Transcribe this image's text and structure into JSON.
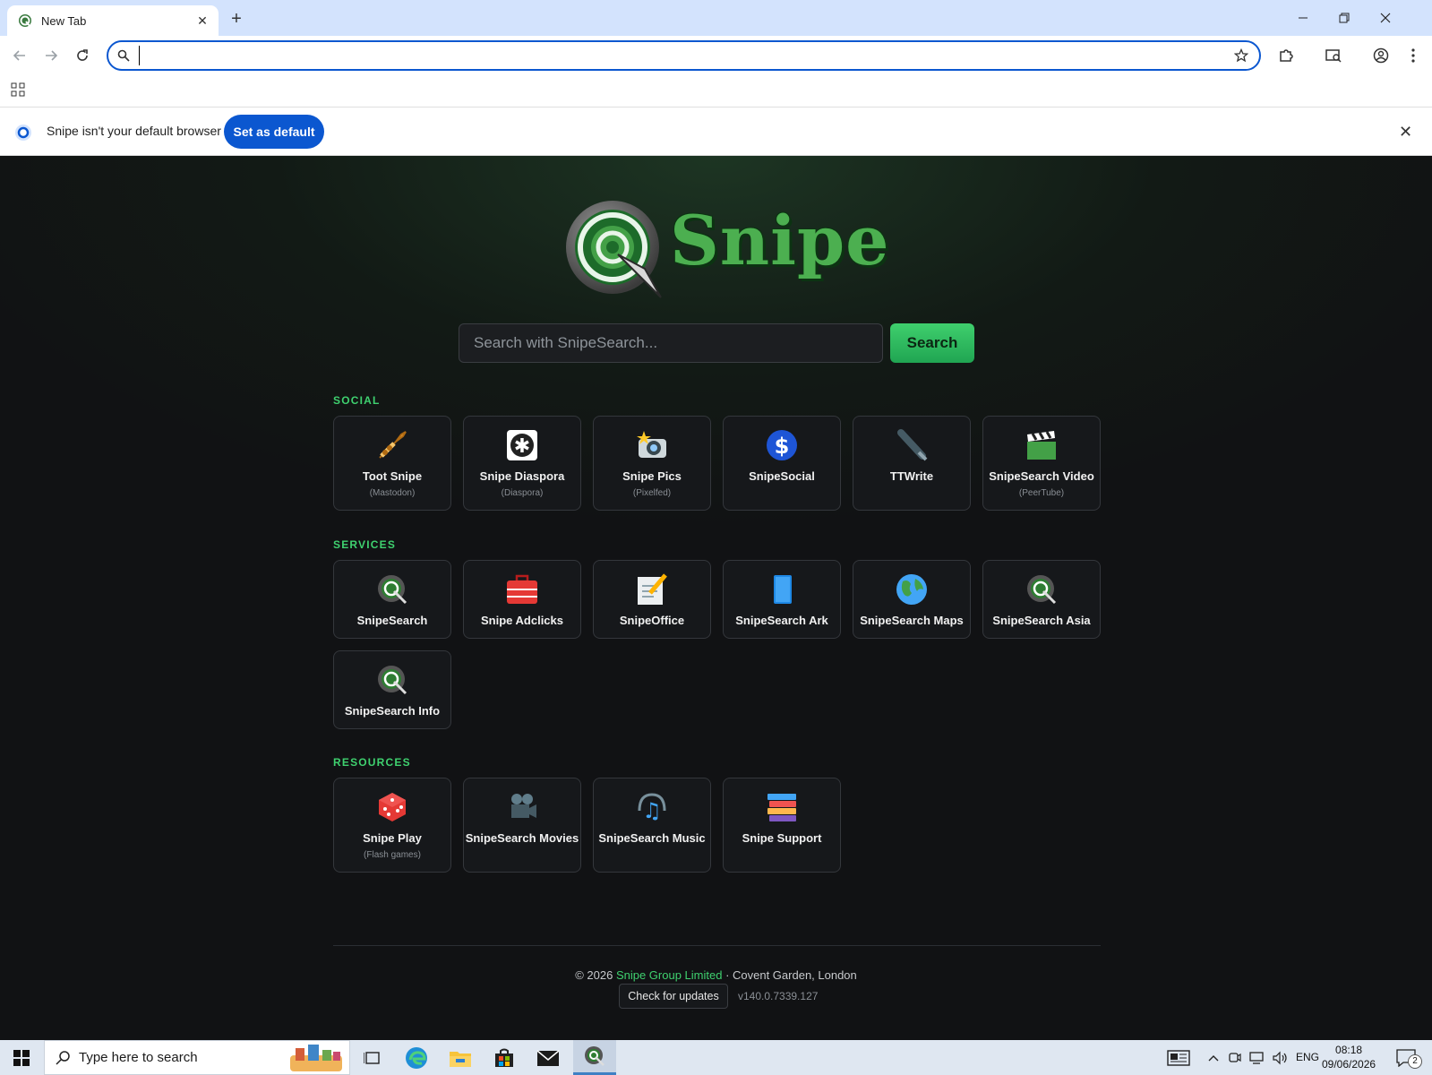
{
  "browser": {
    "tab_title": "New Tab",
    "address_value": "",
    "infobar_text": "Snipe isn't your default browser",
    "infobar_button": "Set as default"
  },
  "page": {
    "logo_text": "Snipe",
    "search_placeholder": "Search with SnipeSearch...",
    "search_button": "Search",
    "sections": [
      {
        "title": "SOCIAL",
        "items": [
          {
            "name": "Toot Snipe",
            "sub": "(Mastodon)",
            "icon": "trumpet-icon"
          },
          {
            "name": "Snipe Diaspora",
            "sub": "(Diaspora)",
            "icon": "asterisk-icon"
          },
          {
            "name": "Snipe Pics",
            "sub": "(Pixelfed)",
            "icon": "camera-flash-icon"
          },
          {
            "name": "SnipeSocial",
            "sub": "",
            "icon": "dollar-s-icon"
          },
          {
            "name": "TTWrite",
            "sub": "",
            "icon": "fountain-pen-icon"
          },
          {
            "name": "SnipeSearch Video",
            "sub": "(PeerTube)",
            "icon": "clapperboard-icon"
          }
        ]
      },
      {
        "title": "SERVICES",
        "items": [
          {
            "name": "SnipeSearch",
            "sub": "",
            "icon": "snipe-logo-icon"
          },
          {
            "name": "Snipe Adclicks",
            "sub": "",
            "icon": "toolbox-icon"
          },
          {
            "name": "SnipeOffice",
            "sub": "",
            "icon": "memo-pencil-icon"
          },
          {
            "name": "SnipeSearch Ark",
            "sub": "",
            "icon": "blue-book-icon"
          },
          {
            "name": "SnipeSearch Maps",
            "sub": "",
            "icon": "globe-icon"
          },
          {
            "name": "SnipeSearch Asia",
            "sub": "",
            "icon": "snipe-logo-icon"
          },
          {
            "name": "SnipeSearch Info",
            "sub": "",
            "icon": "snipe-logo-icon"
          }
        ]
      },
      {
        "title": "RESOURCES",
        "items": [
          {
            "name": "Snipe Play",
            "sub": "(Flash games)",
            "icon": "dice-icon"
          },
          {
            "name": "SnipeSearch Movies",
            "sub": "",
            "icon": "film-camera-icon"
          },
          {
            "name": "SnipeSearch Music",
            "sub": "",
            "icon": "music-note-icon"
          },
          {
            "name": "Snipe Support",
            "sub": "",
            "icon": "books-stack-icon"
          }
        ]
      }
    ],
    "footer": {
      "copyright_prefix": "© 2026 ",
      "company": "Snipe Group Limited",
      "location": " · Covent Garden, London",
      "update_button": "Check for updates",
      "version": "v140.0.7339.127"
    }
  },
  "taskbar": {
    "search_placeholder": "Type here to search",
    "language": "ENG",
    "time": "08:18",
    "date": "09/06/2026",
    "notification_count": "2"
  },
  "colors": {
    "accent": "#3fd16f",
    "chrome_blue": "#0b57d0",
    "titlebar": "#d3e3fd"
  }
}
